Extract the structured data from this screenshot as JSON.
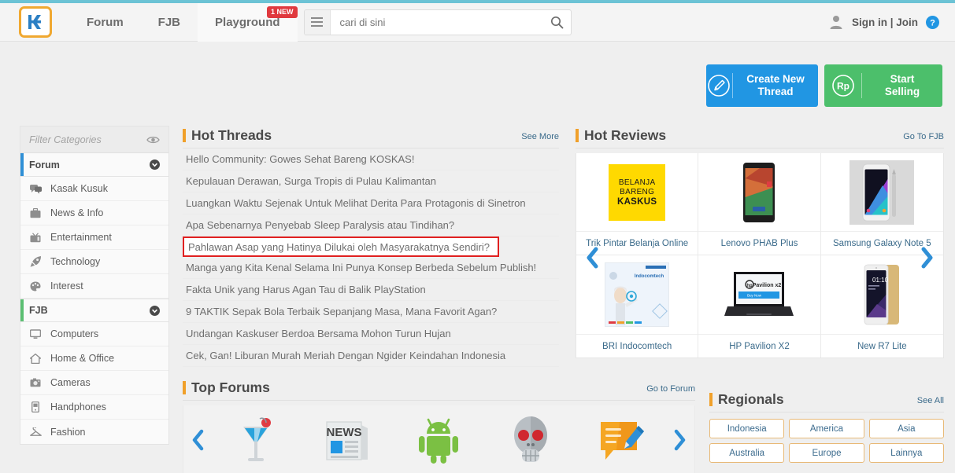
{
  "header": {
    "logo_name": "kaskus-logo",
    "nav": [
      {
        "label": "Forum",
        "badge": null
      },
      {
        "label": "FJB",
        "badge": null
      },
      {
        "label": "Playground",
        "badge": "1 NEW"
      }
    ],
    "search": {
      "placeholder": "cari di sini",
      "value": ""
    },
    "signin_label": "Sign in | Join"
  },
  "actions": {
    "create_thread": "Create New Thread",
    "start_selling": "Start Selling",
    "rp_symbol": "Rp"
  },
  "sidebar": {
    "filter_placeholder": "Filter Categories",
    "groups": [
      {
        "name": "Forum",
        "accent": "#2f8fd6",
        "items": [
          {
            "label": "Kasak Kusuk",
            "icon": "chat-bubbles-icon"
          },
          {
            "label": "News & Info",
            "icon": "briefcase-icon"
          },
          {
            "label": "Entertainment",
            "icon": "tv-icon"
          },
          {
            "label": "Technology",
            "icon": "rocket-icon"
          },
          {
            "label": "Interest",
            "icon": "palette-icon"
          }
        ]
      },
      {
        "name": "FJB",
        "accent": "#5bbf72",
        "items": [
          {
            "label": "Computers",
            "icon": "monitor-icon"
          },
          {
            "label": "Home & Office",
            "icon": "house-icon"
          },
          {
            "label": "Cameras",
            "icon": "camera-icon"
          },
          {
            "label": "Handphones",
            "icon": "phone-icon"
          },
          {
            "label": "Fashion",
            "icon": "hanger-icon"
          }
        ]
      }
    ]
  },
  "hot_threads": {
    "title": "Hot Threads",
    "see_more": "See More",
    "highlight_index": 4,
    "items": [
      "Hello Community: Gowes Sehat Bareng KOSKAS!",
      "Kepulauan Derawan, Surga Tropis di Pulau Kalimantan",
      "Luangkan Waktu Sejenak Untuk Melihat Derita Para Protagonis di Sinetron",
      "Apa Sebenarnya Penyebab Sleep Paralysis atau Tindihan?",
      "Pahlawan Asap yang Hatinya Dilukai oleh Masyarakatnya Sendiri?",
      "Manga yang Kita Kenal Selama Ini Punya Konsep Berbeda Sebelum Publish!",
      "Fakta Unik yang Harus Agan Tau di Balik PlayStation",
      "9 TAKTIK Sepak Bola Terbaik Sepanjang Masa, Mana Favorit Agan?",
      "Undangan Kaskuser Berdoa Bersama Mohon Turun Hujan",
      "Cek, Gan! Liburan Murah Meriah Dengan Ngider Keindahan Indonesia"
    ]
  },
  "top_forums": {
    "title": "Top Forums",
    "link": "Go to Forum",
    "items": [
      {
        "name": "cocktail-glass-icon"
      },
      {
        "name": "newspaper-icon"
      },
      {
        "name": "android-robot-icon"
      },
      {
        "name": "skull-icon"
      },
      {
        "name": "speech-bubble-pencil-icon"
      }
    ]
  },
  "hot_reviews": {
    "title": "Hot Reviews",
    "link": "Go To FJB",
    "items": [
      {
        "caption": "Trik Pintar Belanja Online",
        "thumb": "belanja-bareng-kaskus-banner"
      },
      {
        "caption": "Lenovo PHAB Plus",
        "thumb": "lenovo-phone-photo"
      },
      {
        "caption": "Samsung Galaxy Note 5",
        "thumb": "samsung-note5-photo"
      },
      {
        "caption": "BRI Indocomtech",
        "thumb": "bri-indocomtech-banner"
      },
      {
        "caption": "HP Pavilion X2",
        "thumb": "hp-laptop-photo"
      },
      {
        "caption": "New R7 Lite",
        "thumb": "r7-lite-phone-photo"
      }
    ],
    "banner_text": {
      "line1": "BELANJA",
      "line2": "BARENG",
      "line3": "KASKUS"
    }
  },
  "regionals": {
    "title": "Regionals",
    "link": "See All",
    "items": [
      "Indonesia",
      "America",
      "Asia",
      "Australia",
      "Europe",
      "Lainnya"
    ]
  },
  "colors": {
    "accent_orange": "#f0a02a",
    "brand_blue": "#2196e3",
    "brand_green": "#4cbf6b",
    "highlight_red": "#e02020",
    "top_strip": "#6cc3d5"
  }
}
